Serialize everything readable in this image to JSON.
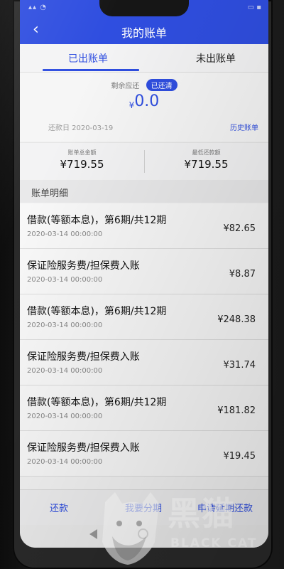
{
  "header": {
    "title": "我的账单"
  },
  "tabs": [
    {
      "label": "已出账单"
    },
    {
      "label": "未出账单"
    }
  ],
  "summary": {
    "remain_label": "剩余应还",
    "status_badge": "已还清",
    "currency": "¥",
    "remain_amount": "0.0",
    "repay_date": "还款日  2020-03-19",
    "history_link": "历史账单"
  },
  "totals": {
    "bill_total_label": "账单总金额",
    "bill_total_value": "¥719.55",
    "min_pay_label": "最低还款额",
    "min_pay_value": "¥719.55"
  },
  "detail": {
    "header": "账单明细",
    "items": [
      {
        "title": "借款(等额本息)，第6期/共12期",
        "date": "2020-03-14 00:00:00",
        "amount": "¥82.65"
      },
      {
        "title": "保证险服务费/担保费入账",
        "date": "2020-03-14 00:00:00",
        "amount": "¥8.87"
      },
      {
        "title": "借款(等额本息)，第6期/共12期",
        "date": "2020-03-14 00:00:00",
        "amount": "¥248.38"
      },
      {
        "title": "保证险服务费/担保费入账",
        "date": "2020-03-14 00:00:00",
        "amount": "¥31.74"
      },
      {
        "title": "借款(等额本息)，第6期/共12期",
        "date": "2020-03-14 00:00:00",
        "amount": "¥181.82"
      },
      {
        "title": "保证险服务费/担保费入账",
        "date": "2020-03-14 00:00:00",
        "amount": "¥19.45"
      }
    ]
  },
  "footer": {
    "repay": "还款",
    "installment": "我要分期",
    "extend": "申请延期还款"
  },
  "watermark": {
    "logo_text": "黑猫",
    "sub_text": "BLACK CAT"
  },
  "colors": {
    "brand_blue": "#2f4ee0",
    "background": "#f3f3f3"
  },
  "icons": {
    "back": "chevron-left-icon",
    "status": "signal-wifi-battery-icons",
    "nav_back": "triangle-back-icon",
    "nav_home": "circle-home-icon"
  }
}
